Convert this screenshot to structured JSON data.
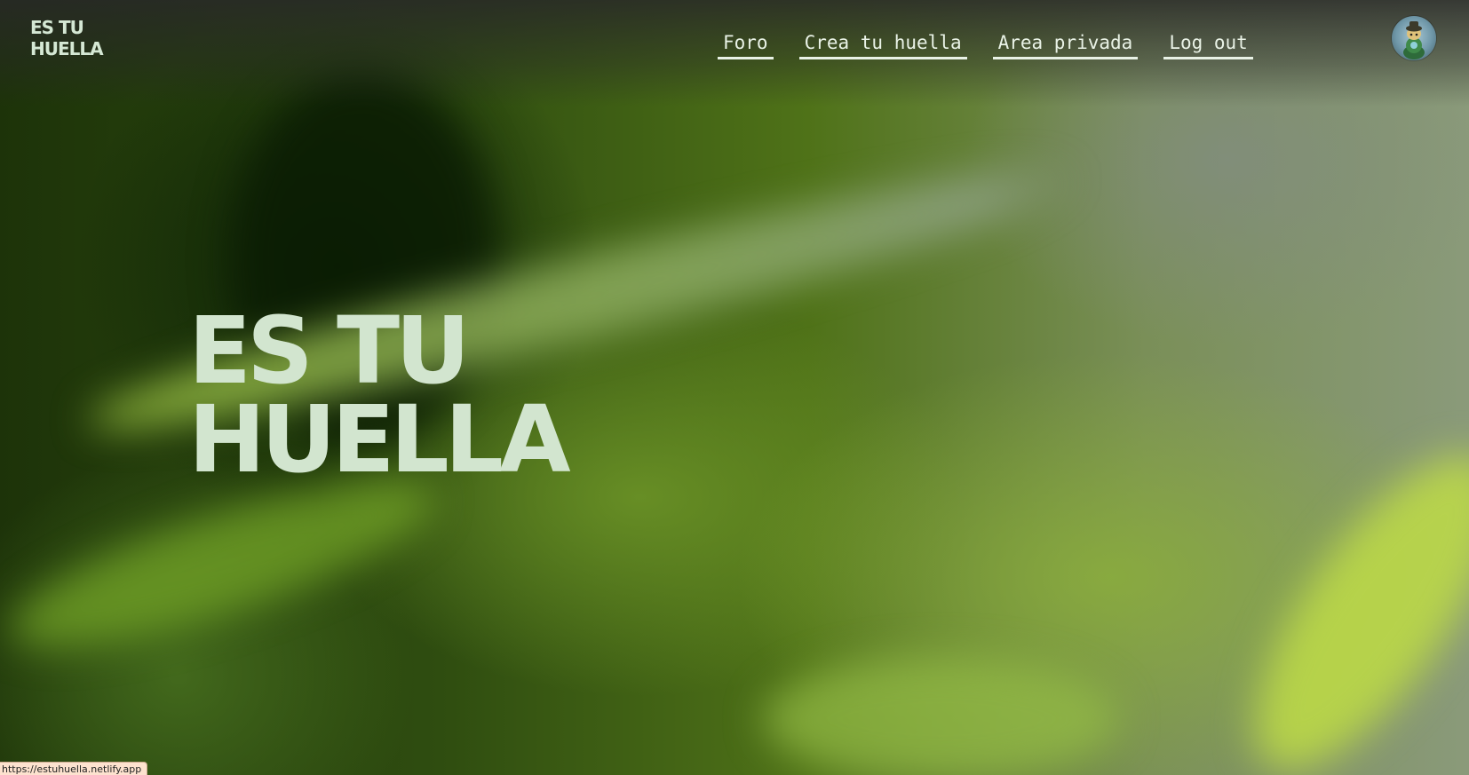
{
  "header": {
    "logo_line1": "ES TU",
    "logo_line2": "HUELLA",
    "nav": [
      {
        "label": "Foro"
      },
      {
        "label": "Crea tu huella"
      },
      {
        "label": "Area privada"
      },
      {
        "label": "Log out"
      }
    ],
    "avatar_icon": "user-avatar-icon"
  },
  "hero": {
    "title_line1": "ES TU",
    "title_line2": "HUELLA"
  },
  "status_bar": {
    "url": "https://estuhuella.netlify.app"
  },
  "colors": {
    "accent_text": "#d2e5cf",
    "nav_text": "#e9f2e6"
  }
}
